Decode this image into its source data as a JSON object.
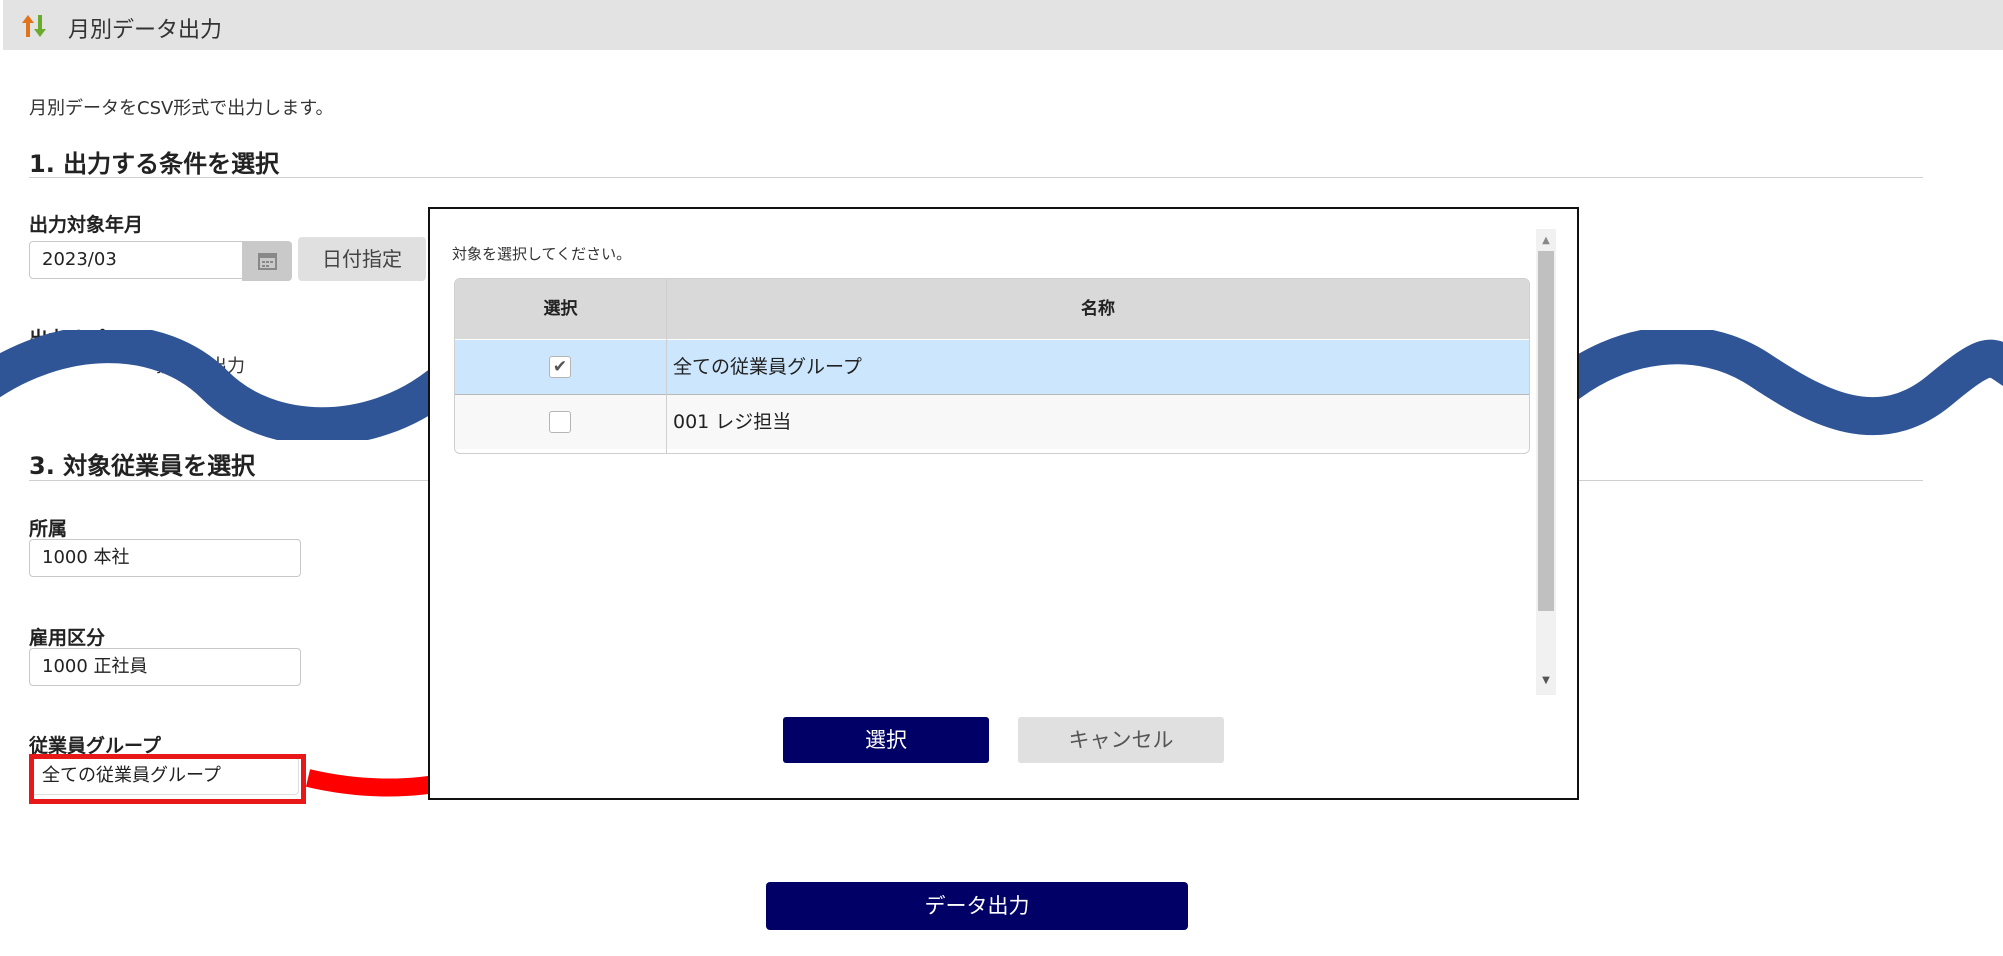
{
  "header": {
    "title": "月別データ出力",
    "icon": "up-down-arrows-icon"
  },
  "description": "月別データをCSV形式で出力します。",
  "section1": {
    "heading": "1. 出力する条件を選択",
    "month_label": "出力対象年月",
    "month_value": "2023/03",
    "date_button_label": "日付指定",
    "option_label": "出力オプション",
    "option_text": "務先で出力"
  },
  "section3": {
    "heading": "3. 対象従業員を選択",
    "department_label": "所属",
    "department_value": "1000 本社",
    "employment_label": "雇用区分",
    "employment_value": "1000 正社員",
    "group_label": "従業員グループ",
    "group_value": "全ての従業員グループ"
  },
  "export_button_label": "データ出力",
  "modal": {
    "instruction": "対象を選択してください。",
    "columns": {
      "select": "選択",
      "name": "名称"
    },
    "rows": [
      {
        "checked": true,
        "check_glyph": "✔",
        "name": "全ての従業員グループ"
      },
      {
        "checked": false,
        "check_glyph": "",
        "name": "001 レジ担当"
      }
    ],
    "select_button_label": "選択",
    "cancel_button_label": "キャンセル"
  },
  "colors": {
    "primary_button": "#000066",
    "highlight": "#e81818",
    "wave": "#2f5596",
    "selected_row": "#cce7fd"
  }
}
